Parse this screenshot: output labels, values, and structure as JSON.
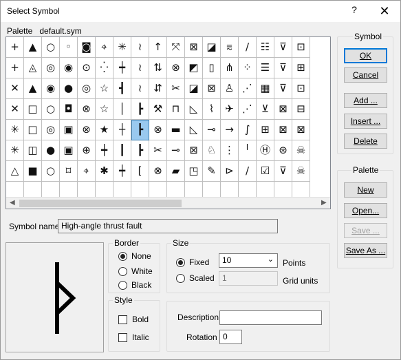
{
  "window": {
    "title": "Select Symbol",
    "help": "?",
    "close": "✕"
  },
  "palette": {
    "label": "Palette",
    "file": "default.sym"
  },
  "symbols": [
    [
      "+",
      "▲",
      "○",
      "◦",
      "◙",
      "⌖",
      "✳",
      "≀",
      "↑",
      "⤧",
      "⊠",
      "◪",
      "⩳",
      "∕",
      "☷",
      "⊽",
      "⊡"
    ],
    [
      "+",
      "◬",
      "◎",
      "◉",
      "⊙",
      "⁛",
      "┿",
      "≀",
      "⇅",
      "⊗",
      "◩",
      "▯",
      "⋔",
      "⁘",
      "☰",
      "⊽",
      "⊞"
    ],
    [
      "✕",
      "▲",
      "◉",
      "●",
      "◎",
      "☆",
      "┫",
      "≀",
      "⇵",
      "✂",
      "◪",
      "⊠",
      "♙",
      "⋰",
      "▦",
      "⊽",
      "⊡"
    ],
    [
      "✕",
      "□",
      "○",
      "◘",
      "⊗",
      "☆",
      "│",
      "┣",
      "⚒",
      "⊓",
      "◺",
      "⌇",
      "✈",
      "⋰",
      "⊻",
      "⊠",
      "⊟"
    ],
    [
      "✳",
      "□",
      "◎",
      "▣",
      "⊗",
      "★",
      "┼",
      "┣",
      "⊗",
      "▬",
      "◺",
      "⊸",
      "→",
      "∫",
      "⊞",
      "⊠",
      "⊠"
    ],
    [
      "✳",
      "◫",
      "●",
      "▣",
      "⊕",
      "┿",
      "┃",
      "┣",
      "✂",
      "⊸",
      "⊠",
      "♘",
      "⋮",
      "╵",
      "Ⓗ",
      "⊛",
      "☠"
    ],
    [
      "△",
      "■",
      "○",
      "⌑",
      "⌖",
      "✱",
      "┿",
      "[",
      "⊗",
      "▰",
      "◳",
      "✎",
      "⊳",
      "∕",
      "☑",
      "⊽",
      "☠"
    ],
    [
      "",
      "",
      "",
      "",
      "",
      "",
      "",
      "",
      "",
      "",
      "",
      "",
      "",
      "",
      "",
      "",
      ""
    ]
  ],
  "selected_symbol": {
    "row": 4,
    "col": 7
  },
  "symbol_name": {
    "label": "Symbol name",
    "value": "High-angle thrust fault"
  },
  "border": {
    "legend": "Border",
    "options": [
      "None",
      "White",
      "Black"
    ],
    "selected": "None"
  },
  "size": {
    "legend": "Size",
    "fixed_label": "Fixed",
    "scaled_label": "Scaled",
    "fixed_value": "10",
    "points_label": "Points",
    "scaled_value": "1",
    "grid_units_label": "Grid units",
    "selected": "Fixed"
  },
  "style": {
    "legend": "Style",
    "bold_label": "Bold",
    "italic_label": "Italic",
    "bold": false,
    "italic": false
  },
  "description": {
    "label": "Description",
    "value": ""
  },
  "rotation": {
    "label": "Rotation",
    "value": "0"
  },
  "symbol_group": {
    "legend": "Symbol",
    "ok": "OK",
    "cancel": "Cancel",
    "add": "Add ...",
    "insert": "Insert ...",
    "delete": "Delete"
  },
  "palette_group": {
    "legend": "Palette",
    "new": "New",
    "open": "Open...",
    "save": "Save ...",
    "save_as": "Save As ..."
  },
  "colors": {
    "selection": "#99c9ef",
    "default_border": "#0078d7"
  }
}
